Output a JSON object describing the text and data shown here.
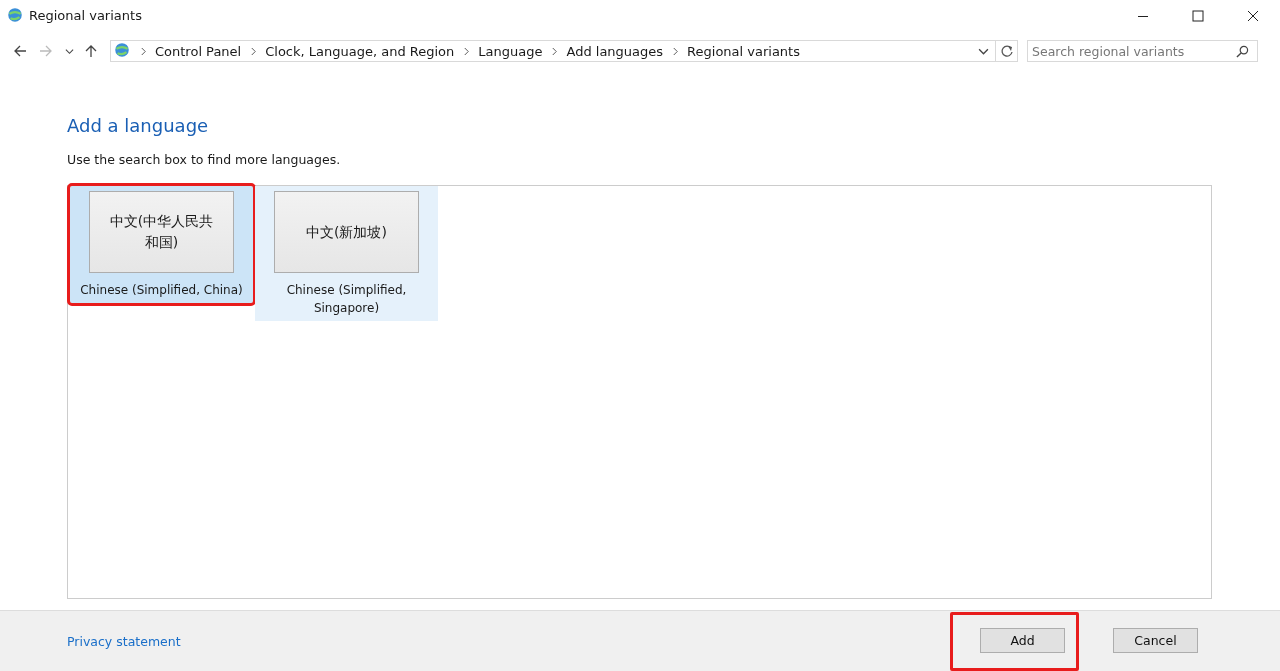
{
  "window": {
    "title": "Regional variants"
  },
  "address_bar": {
    "breadcrumbs": [
      "Control Panel",
      "Clock, Language, and Region",
      "Language",
      "Add languages",
      "Regional variants"
    ]
  },
  "search": {
    "placeholder": "Search regional variants"
  },
  "heading": "Add a language",
  "hint": "Use the search box to find more languages.",
  "languages": [
    {
      "native": "中文(中华人民共和国)",
      "name": "Chinese (Simplified, China)",
      "selected": true,
      "hovered": false,
      "highlighted": true
    },
    {
      "native": "中文(新加坡)",
      "name": "Chinese (Simplified, Singapore)",
      "selected": false,
      "hovered": true,
      "highlighted": false
    }
  ],
  "footer": {
    "link": "Privacy statement",
    "buttons": [
      {
        "label": "Add",
        "highlighted": true
      },
      {
        "label": "Cancel",
        "highlighted": false
      }
    ]
  }
}
